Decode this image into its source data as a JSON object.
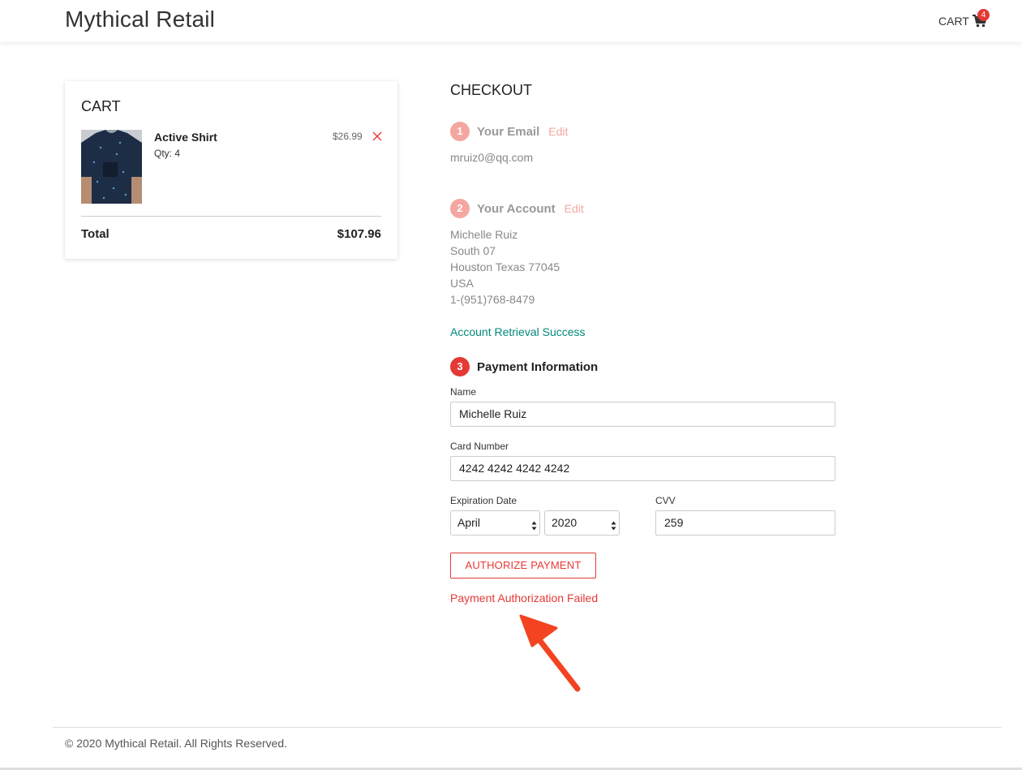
{
  "header": {
    "brand": "Mythical Retail",
    "cart_label": "CART",
    "cart_count": "4"
  },
  "cart": {
    "title": "CART",
    "items": [
      {
        "name": "Active Shirt",
        "qty": "Qty: 4",
        "price": "$26.99"
      }
    ],
    "total_label": "Total",
    "total_value": "$107.96"
  },
  "checkout": {
    "title": "CHECKOUT",
    "step1": {
      "num": "1",
      "title": "Your Email",
      "edit": "Edit",
      "email": "mruiz0@qq.com"
    },
    "step2": {
      "num": "2",
      "title": "Your Account",
      "edit": "Edit",
      "lines": [
        "Michelle Ruiz",
        "South 07",
        "Houston Texas 77045",
        "USA",
        "1-(951)768-8479"
      ],
      "status": "Account Retrieval Success"
    },
    "step3": {
      "num": "3",
      "title": "Payment Information",
      "name_label": "Name",
      "name_value": "Michelle Ruiz",
      "card_label": "Card Number",
      "card_value": "4242 4242 4242 4242",
      "exp_label": "Expiration Date",
      "exp_month": "April",
      "exp_year": "2020",
      "cvv_label": "CVV",
      "cvv_value": "259",
      "button": "AUTHORIZE PAYMENT",
      "error": "Payment Authorization Failed"
    }
  },
  "footer": {
    "copyright": "© 2020 Mythical Retail. All Rights Reserved."
  },
  "colors": {
    "accent": "#e53935",
    "accent_light": "#f4a7a0",
    "success": "#00897b"
  }
}
